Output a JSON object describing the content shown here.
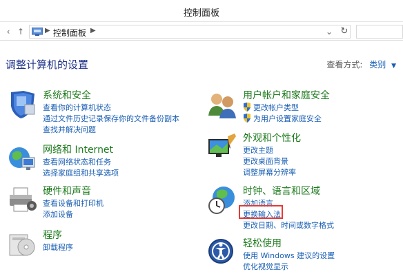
{
  "window": {
    "title": "控制面板"
  },
  "nav": {
    "back_icon": "back-arrow-icon",
    "forward_icon": "forward-arrow-icon",
    "up_icon": "up-arrow-icon",
    "breadcrumb": [
      "控制面板"
    ],
    "search_placeholder": ""
  },
  "header": {
    "title": "调整计算机的设置",
    "view_by_label": "查看方式:",
    "view_by_value": "类别"
  },
  "categories_left": [
    {
      "title": "系统和安全",
      "icon": "shield-icon",
      "links": [
        "查看你的计算机状态",
        "通过文件历史记录保存你的文件备份副本",
        "查找并解决问题"
      ]
    },
    {
      "title": "网络和 Internet",
      "icon": "network-globe-icon",
      "links": [
        "查看网络状态和任务",
        "选择家庭组和共享选项"
      ]
    },
    {
      "title": "硬件和声音",
      "icon": "printer-icon",
      "links": [
        "查看设备和打印机",
        "添加设备"
      ]
    },
    {
      "title": "程序",
      "icon": "programs-icon",
      "links": [
        "卸载程序"
      ]
    }
  ],
  "categories_right": [
    {
      "title": "用户帐户和家庭安全",
      "icon": "users-icon",
      "links": [
        "更改帐户类型",
        "为用户设置家庭安全"
      ]
    },
    {
      "title": "外观和个性化",
      "icon": "appearance-icon",
      "links": [
        "更改主题",
        "更改桌面背景",
        "调整屏幕分辨率"
      ]
    },
    {
      "title": "时钟、语言和区域",
      "icon": "clock-globe-icon",
      "links": [
        "添加语言",
        "更换输入法",
        "更改日期、时间或数字格式"
      ]
    },
    {
      "title": "轻松使用",
      "icon": "ease-of-access-icon",
      "links": [
        "使用 Windows 建议的设置",
        "优化视觉显示"
      ]
    }
  ],
  "colors": {
    "category_title": "#1d7a1d",
    "link": "#1a5fb4",
    "heading": "#1e3287",
    "highlight_border": "#e53935"
  }
}
